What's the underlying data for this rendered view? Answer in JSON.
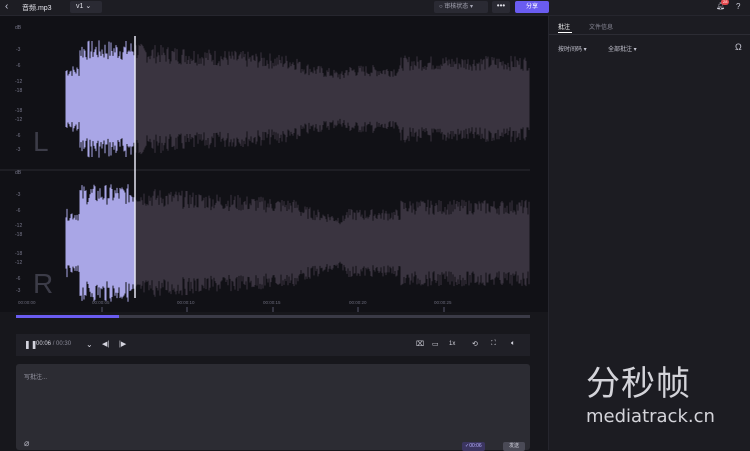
{
  "header": {
    "back_icon": "chevron-left-icon",
    "file_name": "音频.mp3",
    "version": "v1",
    "review_status": "审核状态",
    "more": "•••",
    "share": "分享",
    "notification_count": "28",
    "help": "?"
  },
  "waveform": {
    "db_scale_unit": "dB",
    "left_channel": {
      "label": "L",
      "db_ticks": [
        "-3",
        "-6",
        "-12",
        "-18",
        "-18",
        "-12",
        "-6",
        "-3"
      ]
    },
    "right_channel": {
      "label": "R",
      "db_ticks": [
        "-3",
        "-6",
        "-12",
        "-18",
        "-18",
        "-12",
        "-6",
        "-3"
      ]
    },
    "time_ticks": [
      "00:00:00",
      "00:00:05",
      "00:00:10",
      "00:00:15",
      "00:00:20",
      "00:00:25"
    ],
    "played_fraction": 0.2,
    "played_color": "#a9a6e6",
    "unplayed_color": "#3a3440"
  },
  "player": {
    "progress_fraction": 0.2,
    "current_time": "00:06",
    "duration": "/ 00:30",
    "speed": "1x",
    "accent_color": "#6a5cf0"
  },
  "comment": {
    "placeholder": "写批注...",
    "time_tag": "00:06",
    "send": "发送"
  },
  "sidebar": {
    "tabs": [
      "批注",
      "文件信息"
    ],
    "active_tab": 0,
    "sort_filter": "按时间码 ▾",
    "scope_filter": "全部批注 ▾"
  },
  "watermark": {
    "cn": "分秒帧",
    "en": "mediatrack.cn"
  }
}
